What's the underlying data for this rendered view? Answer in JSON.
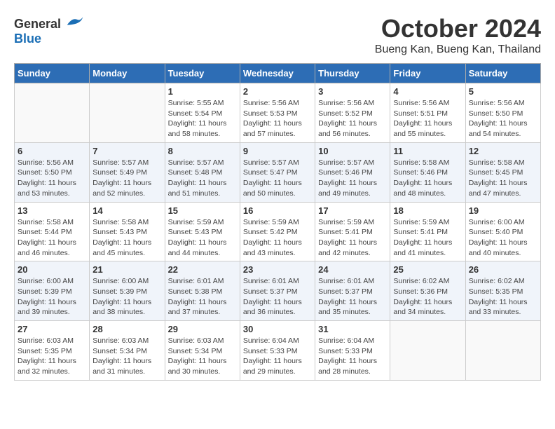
{
  "header": {
    "logo_general": "General",
    "logo_blue": "Blue",
    "month_title": "October 2024",
    "location": "Bueng Kan, Bueng Kan, Thailand"
  },
  "weekdays": [
    "Sunday",
    "Monday",
    "Tuesday",
    "Wednesday",
    "Thursday",
    "Friday",
    "Saturday"
  ],
  "weeks": [
    [
      {
        "day": "",
        "sunrise": "",
        "sunset": "",
        "daylight": ""
      },
      {
        "day": "",
        "sunrise": "",
        "sunset": "",
        "daylight": ""
      },
      {
        "day": "1",
        "sunrise": "Sunrise: 5:55 AM",
        "sunset": "Sunset: 5:54 PM",
        "daylight": "Daylight: 11 hours and 58 minutes."
      },
      {
        "day": "2",
        "sunrise": "Sunrise: 5:56 AM",
        "sunset": "Sunset: 5:53 PM",
        "daylight": "Daylight: 11 hours and 57 minutes."
      },
      {
        "day": "3",
        "sunrise": "Sunrise: 5:56 AM",
        "sunset": "Sunset: 5:52 PM",
        "daylight": "Daylight: 11 hours and 56 minutes."
      },
      {
        "day": "4",
        "sunrise": "Sunrise: 5:56 AM",
        "sunset": "Sunset: 5:51 PM",
        "daylight": "Daylight: 11 hours and 55 minutes."
      },
      {
        "day": "5",
        "sunrise": "Sunrise: 5:56 AM",
        "sunset": "Sunset: 5:50 PM",
        "daylight": "Daylight: 11 hours and 54 minutes."
      }
    ],
    [
      {
        "day": "6",
        "sunrise": "Sunrise: 5:56 AM",
        "sunset": "Sunset: 5:50 PM",
        "daylight": "Daylight: 11 hours and 53 minutes."
      },
      {
        "day": "7",
        "sunrise": "Sunrise: 5:57 AM",
        "sunset": "Sunset: 5:49 PM",
        "daylight": "Daylight: 11 hours and 52 minutes."
      },
      {
        "day": "8",
        "sunrise": "Sunrise: 5:57 AM",
        "sunset": "Sunset: 5:48 PM",
        "daylight": "Daylight: 11 hours and 51 minutes."
      },
      {
        "day": "9",
        "sunrise": "Sunrise: 5:57 AM",
        "sunset": "Sunset: 5:47 PM",
        "daylight": "Daylight: 11 hours and 50 minutes."
      },
      {
        "day": "10",
        "sunrise": "Sunrise: 5:57 AM",
        "sunset": "Sunset: 5:46 PM",
        "daylight": "Daylight: 11 hours and 49 minutes."
      },
      {
        "day": "11",
        "sunrise": "Sunrise: 5:58 AM",
        "sunset": "Sunset: 5:46 PM",
        "daylight": "Daylight: 11 hours and 48 minutes."
      },
      {
        "day": "12",
        "sunrise": "Sunrise: 5:58 AM",
        "sunset": "Sunset: 5:45 PM",
        "daylight": "Daylight: 11 hours and 47 minutes."
      }
    ],
    [
      {
        "day": "13",
        "sunrise": "Sunrise: 5:58 AM",
        "sunset": "Sunset: 5:44 PM",
        "daylight": "Daylight: 11 hours and 46 minutes."
      },
      {
        "day": "14",
        "sunrise": "Sunrise: 5:58 AM",
        "sunset": "Sunset: 5:43 PM",
        "daylight": "Daylight: 11 hours and 45 minutes."
      },
      {
        "day": "15",
        "sunrise": "Sunrise: 5:59 AM",
        "sunset": "Sunset: 5:43 PM",
        "daylight": "Daylight: 11 hours and 44 minutes."
      },
      {
        "day": "16",
        "sunrise": "Sunrise: 5:59 AM",
        "sunset": "Sunset: 5:42 PM",
        "daylight": "Daylight: 11 hours and 43 minutes."
      },
      {
        "day": "17",
        "sunrise": "Sunrise: 5:59 AM",
        "sunset": "Sunset: 5:41 PM",
        "daylight": "Daylight: 11 hours and 42 minutes."
      },
      {
        "day": "18",
        "sunrise": "Sunrise: 5:59 AM",
        "sunset": "Sunset: 5:41 PM",
        "daylight": "Daylight: 11 hours and 41 minutes."
      },
      {
        "day": "19",
        "sunrise": "Sunrise: 6:00 AM",
        "sunset": "Sunset: 5:40 PM",
        "daylight": "Daylight: 11 hours and 40 minutes."
      }
    ],
    [
      {
        "day": "20",
        "sunrise": "Sunrise: 6:00 AM",
        "sunset": "Sunset: 5:39 PM",
        "daylight": "Daylight: 11 hours and 39 minutes."
      },
      {
        "day": "21",
        "sunrise": "Sunrise: 6:00 AM",
        "sunset": "Sunset: 5:39 PM",
        "daylight": "Daylight: 11 hours and 38 minutes."
      },
      {
        "day": "22",
        "sunrise": "Sunrise: 6:01 AM",
        "sunset": "Sunset: 5:38 PM",
        "daylight": "Daylight: 11 hours and 37 minutes."
      },
      {
        "day": "23",
        "sunrise": "Sunrise: 6:01 AM",
        "sunset": "Sunset: 5:37 PM",
        "daylight": "Daylight: 11 hours and 36 minutes."
      },
      {
        "day": "24",
        "sunrise": "Sunrise: 6:01 AM",
        "sunset": "Sunset: 5:37 PM",
        "daylight": "Daylight: 11 hours and 35 minutes."
      },
      {
        "day": "25",
        "sunrise": "Sunrise: 6:02 AM",
        "sunset": "Sunset: 5:36 PM",
        "daylight": "Daylight: 11 hours and 34 minutes."
      },
      {
        "day": "26",
        "sunrise": "Sunrise: 6:02 AM",
        "sunset": "Sunset: 5:35 PM",
        "daylight": "Daylight: 11 hours and 33 minutes."
      }
    ],
    [
      {
        "day": "27",
        "sunrise": "Sunrise: 6:03 AM",
        "sunset": "Sunset: 5:35 PM",
        "daylight": "Daylight: 11 hours and 32 minutes."
      },
      {
        "day": "28",
        "sunrise": "Sunrise: 6:03 AM",
        "sunset": "Sunset: 5:34 PM",
        "daylight": "Daylight: 11 hours and 31 minutes."
      },
      {
        "day": "29",
        "sunrise": "Sunrise: 6:03 AM",
        "sunset": "Sunset: 5:34 PM",
        "daylight": "Daylight: 11 hours and 30 minutes."
      },
      {
        "day": "30",
        "sunrise": "Sunrise: 6:04 AM",
        "sunset": "Sunset: 5:33 PM",
        "daylight": "Daylight: 11 hours and 29 minutes."
      },
      {
        "day": "31",
        "sunrise": "Sunrise: 6:04 AM",
        "sunset": "Sunset: 5:33 PM",
        "daylight": "Daylight: 11 hours and 28 minutes."
      },
      {
        "day": "",
        "sunrise": "",
        "sunset": "",
        "daylight": ""
      },
      {
        "day": "",
        "sunrise": "",
        "sunset": "",
        "daylight": ""
      }
    ]
  ]
}
